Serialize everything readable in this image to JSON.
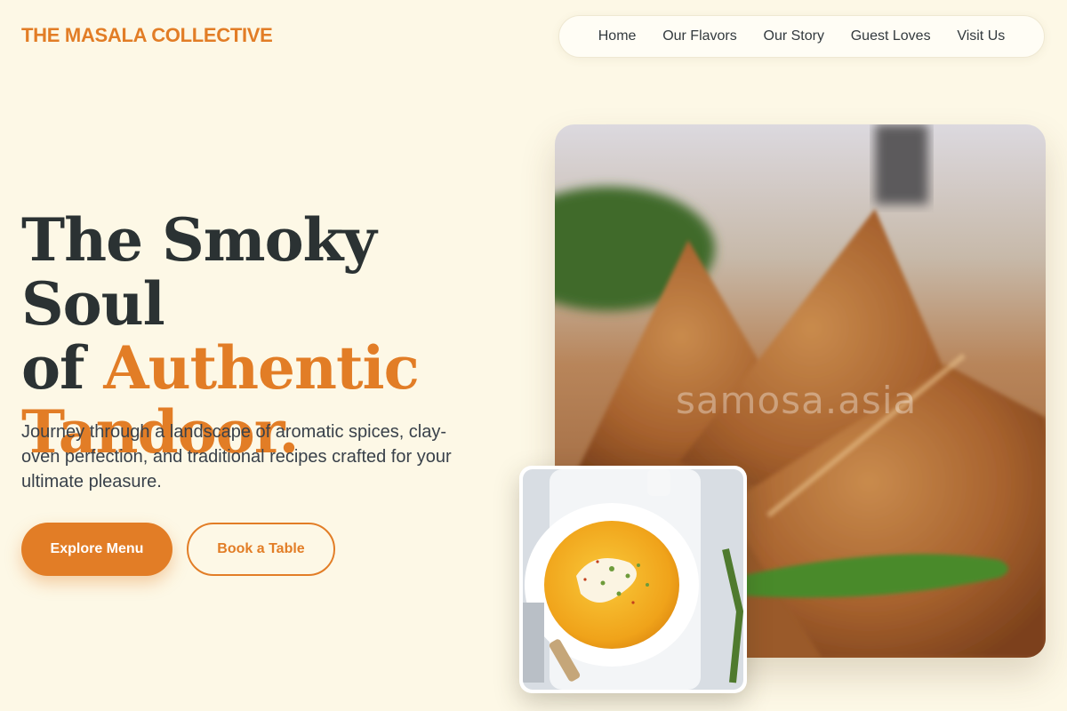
{
  "brand": {
    "name": "THE MASALA COLLECTIVE"
  },
  "nav": {
    "items": [
      {
        "label": "Home"
      },
      {
        "label": "Our Flavors"
      },
      {
        "label": "Our Story"
      },
      {
        "label": "Guest Loves"
      },
      {
        "label": "Visit Us"
      }
    ]
  },
  "hero": {
    "headline_line1": "The Smoky Soul",
    "headline_of": "of ",
    "headline_accent1": "Authentic",
    "headline_accent2": "Tandoor.",
    "lede": "Journey through a landscape of aromatic spices, clay-oven perfection, and traditional recipes crafted for your ultimate pleasure.",
    "primary_button": "Explore Menu",
    "secondary_button": "Book a Table"
  },
  "image": {
    "watermark": "samosa.asia"
  },
  "colors": {
    "accent": "#e27d26",
    "background": "#fdf8e6",
    "heading": "#2b3233"
  }
}
